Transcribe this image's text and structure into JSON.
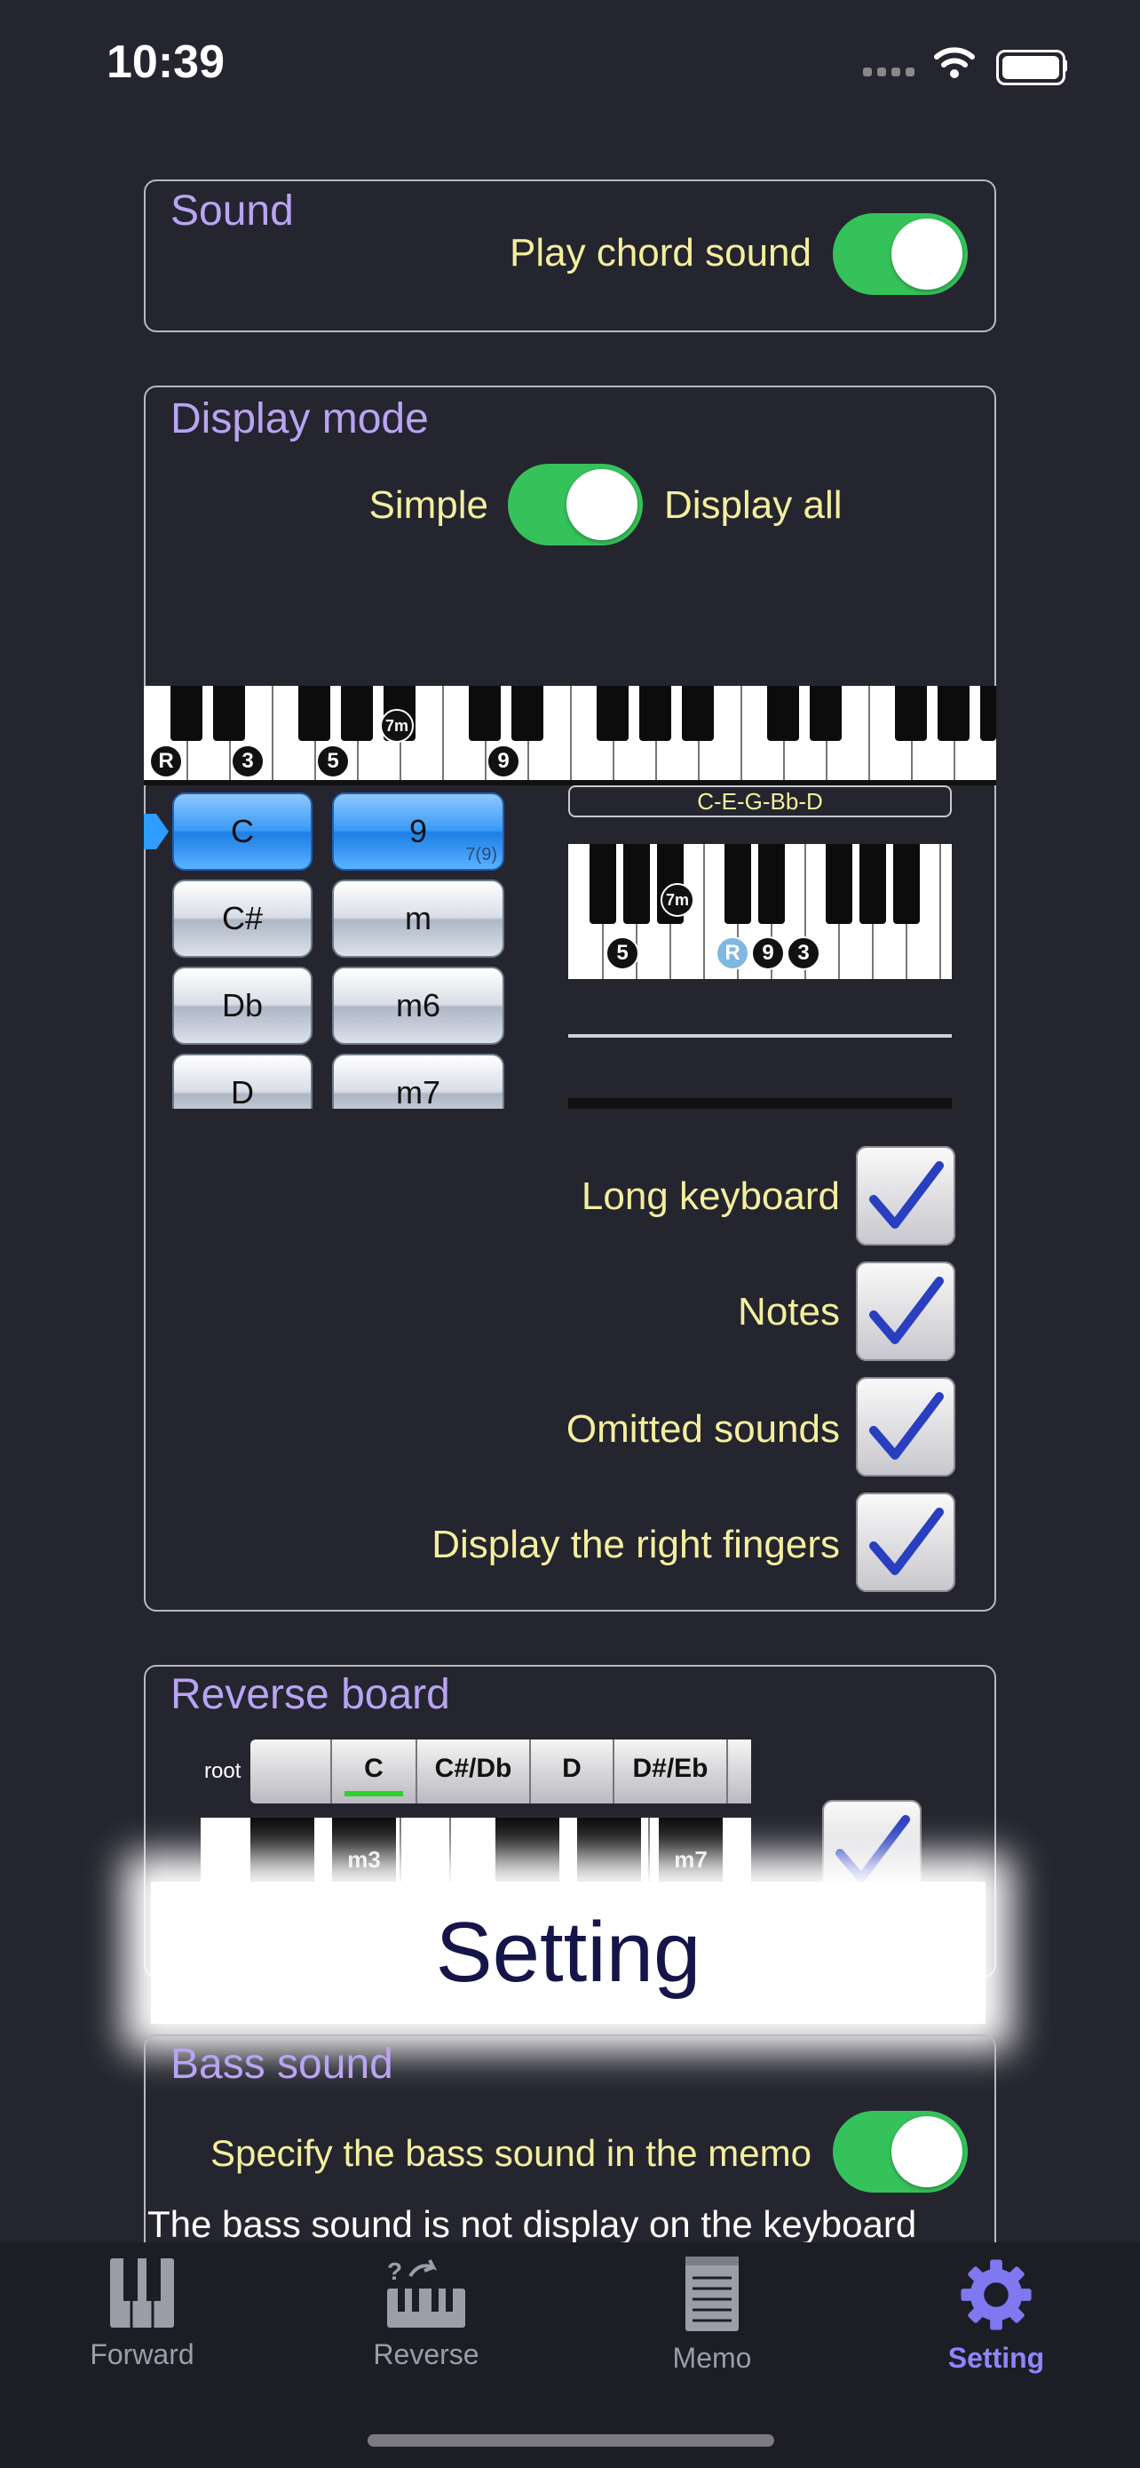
{
  "status_bar": {
    "time": "10:39"
  },
  "sound": {
    "title": "Sound",
    "play_chord_label": "Play chord sound",
    "play_chord_on": true
  },
  "display_mode": {
    "title": "Display mode",
    "simple_label": "Simple",
    "display_all_label": "Display all",
    "toggle_on": true,
    "top_keyboard_markers": [
      "R",
      "3",
      "5",
      "7m",
      "9"
    ],
    "roots": [
      "C",
      "C#",
      "Db",
      "D"
    ],
    "qualities": [
      "9",
      "m",
      "m6",
      "m7"
    ],
    "quality_sub": "7(9)",
    "chord_notes": "C-E-G-Bb-D",
    "preview_markers": [
      "5",
      "7m",
      "R",
      "9",
      "3"
    ],
    "options": [
      {
        "label": "Long keyboard",
        "checked": true
      },
      {
        "label": "Notes",
        "checked": true
      },
      {
        "label": "Omitted sounds",
        "checked": true
      },
      {
        "label": "Display the right fingers",
        "checked": true
      }
    ]
  },
  "reverse_board": {
    "title": "Reverse board",
    "root_label": "root",
    "roots": [
      "C",
      "C#/Db",
      "D",
      "D#/Eb"
    ],
    "key_labels": [
      "m3",
      "m7"
    ]
  },
  "overlay": {
    "text": "Setting"
  },
  "bass_sound": {
    "title": "Bass sound",
    "specify_label": "Specify the bass sound in the memo",
    "specify_on": true,
    "note": "The bass sound is not display on the keyboard"
  },
  "tabs": [
    {
      "label": "Forward",
      "icon": "piano-keys-icon"
    },
    {
      "label": "Reverse",
      "icon": "reverse-piano-icon"
    },
    {
      "label": "Memo",
      "icon": "notepad-icon"
    },
    {
      "label": "Setting",
      "icon": "gear-icon",
      "active": true
    }
  ]
}
